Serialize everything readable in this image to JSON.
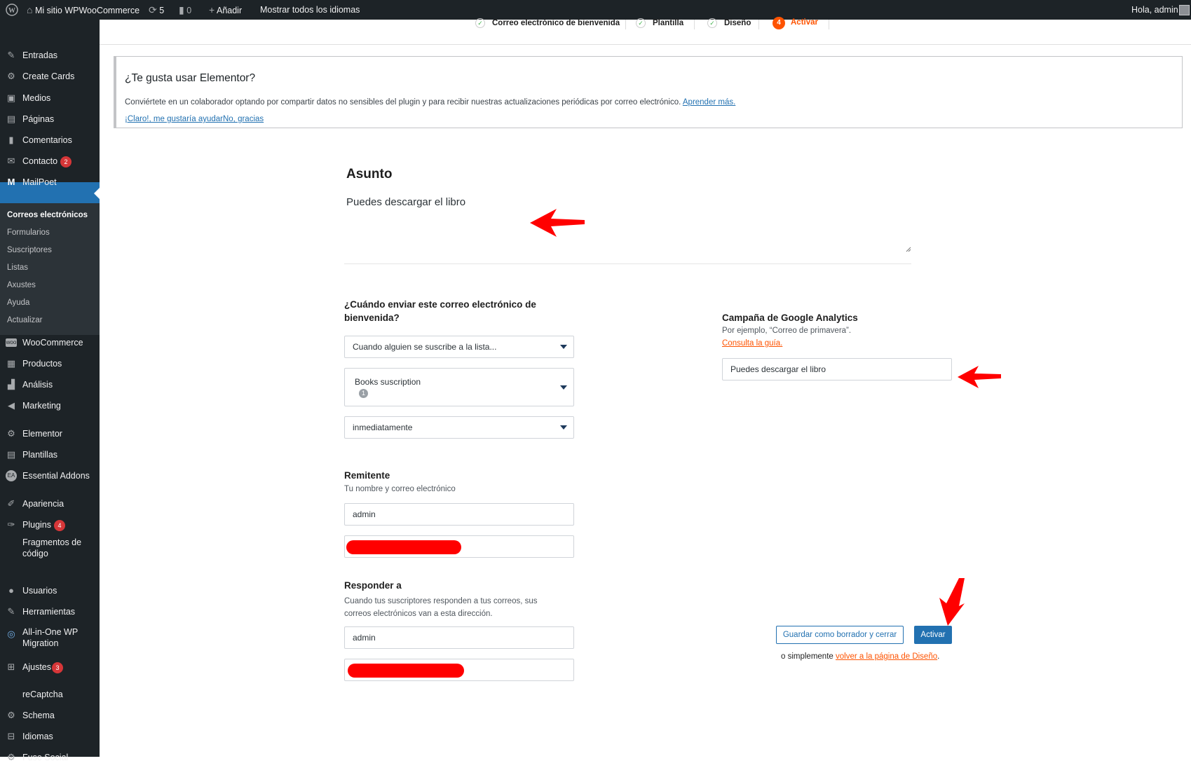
{
  "adminbar": {
    "site_name": "Mi sitio WPWooCommerce",
    "updates_count": "5",
    "comments_count": "0",
    "add_new": "Añadir",
    "languages": "Mostrar todos los idiomas",
    "greeting": "Hola, admin"
  },
  "sidebar": {
    "items": [
      {
        "label": "Entradas",
        "icon": "pin-icon"
      },
      {
        "label": "Create Cards",
        "icon": "gear-icon"
      },
      {
        "label": "Medios",
        "icon": "media-icon"
      },
      {
        "label": "Páginas",
        "icon": "page-icon"
      },
      {
        "label": "Comentarios",
        "icon": "comment-icon"
      },
      {
        "label": "Contacto",
        "icon": "mail-icon",
        "badge": "2"
      },
      {
        "label": "MailPoet",
        "icon": "mailpoet-icon"
      },
      {
        "label": "WooCommerce",
        "icon": "woo-icon"
      },
      {
        "label": "Productos",
        "icon": "archive-icon"
      },
      {
        "label": "Análisis",
        "icon": "chart-icon"
      },
      {
        "label": "Marketing",
        "icon": "megaphone-icon"
      },
      {
        "label": "Elementor",
        "icon": "gear-icon"
      },
      {
        "label": "Plantillas",
        "icon": "page-icon"
      },
      {
        "label": "Essential Addons",
        "icon": "ea-icon"
      },
      {
        "label": "Apariencia",
        "icon": "brush-icon"
      },
      {
        "label": "Plugins",
        "icon": "plug-icon",
        "badge": "4"
      },
      {
        "label": "Fragmentos de código",
        "icon": ""
      },
      {
        "label": "Usuarios",
        "icon": "user-icon"
      },
      {
        "label": "Herramientas",
        "icon": "wrench-icon"
      },
      {
        "label": "All-in-One WP Migration",
        "icon": "migration-icon"
      },
      {
        "label": "Ajustes",
        "icon": "settings-icon",
        "badge": "3"
      },
      {
        "label": "reCaptcha",
        "icon": ""
      },
      {
        "label": "Schema",
        "icon": "gear-icon"
      },
      {
        "label": "Idiomas",
        "icon": "translate-icon"
      },
      {
        "label": "Fuse Social",
        "icon": "gear-icon"
      }
    ],
    "submenu": [
      "Correos electrónicos",
      "Formularios",
      "Suscriptores",
      "Listas",
      "Axustes",
      "Ayuda",
      "Actualizar"
    ]
  },
  "steps": [
    {
      "label": "Correo electrónico de bienvenida"
    },
    {
      "label": "Plantilla"
    },
    {
      "label": "Diseño"
    },
    {
      "label": "Activar",
      "number": "4"
    }
  ],
  "notice": {
    "title": "¿Te gusta usar Elementor?",
    "text": "Conviértete en un colaborador optando por compartir datos no sensibles del plugin y para recibir nuestras actualizaciones periódicas por correo electrónico.",
    "learn_more": "Aprender más.",
    "yes": "¡Claro!, me gustaría ayudar",
    "no": "No, gracias"
  },
  "subject": {
    "label": "Asunto",
    "value": "Puedes descargar el libro"
  },
  "send": {
    "label": "¿Cuándo enviar este correo electrónico de bienvenida?",
    "event": "Cuando alguien se suscribe a la lista...",
    "list": "Books suscription",
    "list_count": "1",
    "timing": "inmediatamente"
  },
  "sender": {
    "label": "Remitente",
    "desc": "Tu nombre y correo electrónico",
    "name": "admin"
  },
  "reply": {
    "label": "Responder a",
    "desc": "Cuando tus suscriptores responden a tus correos, sus correos electrónicos van a esta dirección.",
    "name": "admin"
  },
  "ga": {
    "label": "Campaña de Google Analytics",
    "desc": "Por ejemplo, “Correo de primavera”.",
    "guide": "Consulta la guía.",
    "value": "Puedes descargar el libro"
  },
  "actions": {
    "draft": "Guardar como borrador y cerrar",
    "activate": "Activar",
    "or": "o simplemente",
    "back": "volver a la página de Diseño",
    "period": "."
  },
  "colors": {
    "accent": "#2271b1",
    "mailpoet_orange": "#fe5301",
    "annotation_red": "#ff0000"
  }
}
